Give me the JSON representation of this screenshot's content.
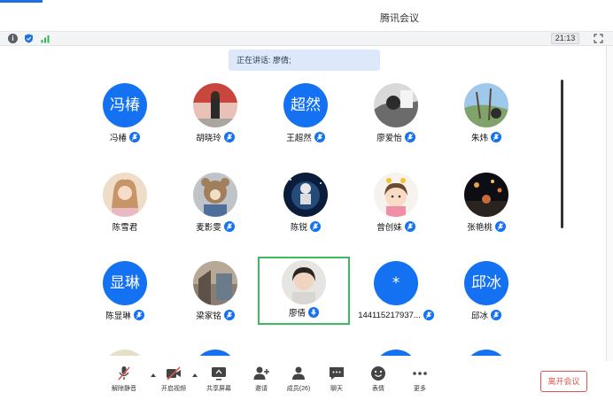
{
  "window": {
    "title": "腾讯会议"
  },
  "statusbar": {
    "time": "21:13"
  },
  "banner": {
    "speaking": "正在讲话: 廖倩;"
  },
  "participants": [
    {
      "name": "冯椿",
      "avatar_text": "冯椿",
      "avatar_type": "text"
    },
    {
      "name": "胡晓玲",
      "avatar_type": "photo"
    },
    {
      "name": "王超然",
      "avatar_text": "超然",
      "avatar_type": "text"
    },
    {
      "name": "廖爱怡",
      "avatar_type": "photo"
    },
    {
      "name": "朱炜",
      "avatar_type": "photo"
    },
    {
      "name": "陈雪君",
      "avatar_type": "photo"
    },
    {
      "name": "麦影雯",
      "avatar_type": "photo"
    },
    {
      "name": "陈锐",
      "avatar_type": "photo"
    },
    {
      "name": "曾创妹",
      "avatar_type": "photo"
    },
    {
      "name": "张艳桃",
      "avatar_type": "photo"
    },
    {
      "name": "陈显琳",
      "avatar_text": "显琳",
      "avatar_type": "text"
    },
    {
      "name": "梁家铭",
      "avatar_type": "photo"
    },
    {
      "name": "廖倩",
      "avatar_type": "photo",
      "active": true
    },
    {
      "name": "144115217937...",
      "avatar_text": "*",
      "avatar_type": "text"
    },
    {
      "name": "邱冰",
      "avatar_text": "邱冰",
      "avatar_type": "text"
    }
  ],
  "toolbar": {
    "unmute": "解除静音",
    "video": "开启视频",
    "share": "共享屏幕",
    "invite": "邀请",
    "members": "成员(26)",
    "chat": "聊天",
    "reactions": "表情",
    "more": "更多",
    "leave": "离开会议"
  }
}
